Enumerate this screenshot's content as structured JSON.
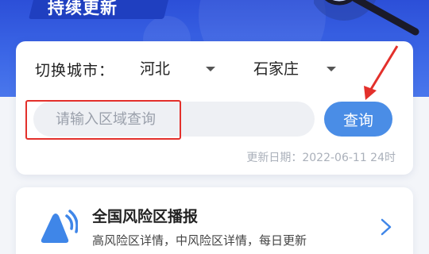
{
  "banner": {
    "title": "持续更新"
  },
  "search_card": {
    "city_label": "切换城市：",
    "province": "河北",
    "city": "石家庄",
    "search_placeholder": "请输入区域查询",
    "query_button": "查询",
    "update_date": "更新日期：2022-06-11 24时"
  },
  "risk_card": {
    "title": "全国风险区播报",
    "subtitle": "高风险区详情，中风险区详情，每日更新",
    "icon": "broadcast-icon"
  },
  "colors": {
    "banner_blue": "#3b66e6",
    "button_blue": "#4a8de6",
    "annotation_red": "#e3302b"
  }
}
